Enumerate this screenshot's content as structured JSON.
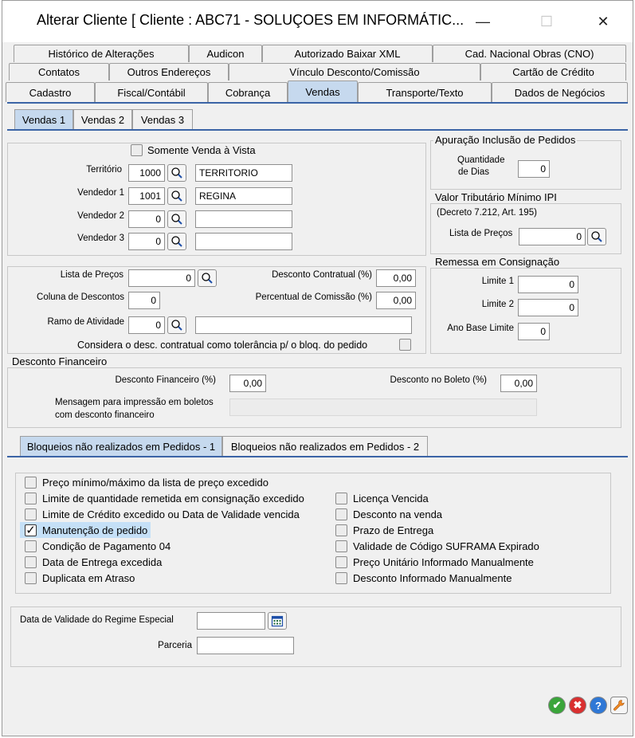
{
  "window": {
    "title": "Alterar Cliente [ Cliente : ABC71 - SOLUÇOES EM INFORMÁTIC...",
    "minimize": "—",
    "maximize": "☐",
    "close": "✕"
  },
  "tabs": {
    "row1": [
      "Histórico de Alterações",
      "Audicon",
      "Autorizado Baixar XML",
      "Cad. Nacional Obras (CNO)"
    ],
    "row2": [
      "Contatos",
      "Outros Endereços",
      "Vínculo Desconto/Comissão",
      "Cartão de Crédito"
    ],
    "row3": [
      "Cadastro",
      "Fiscal/Contábil",
      "Cobrança",
      "Vendas",
      "Transporte/Texto",
      "Dados de Negócios"
    ],
    "active": "Vendas"
  },
  "subtabs": [
    "Vendas 1",
    "Vendas 2",
    "Vendas 3"
  ],
  "vendas_group": {
    "somente_vista_label": "Somente Venda à Vista",
    "territorio_label": "Território",
    "territorio_code": "1000",
    "territorio_name": "TERRITORIO",
    "vendedor1_label": "Vendedor 1",
    "vendedor1_code": "1001",
    "vendedor1_name": "REGINA",
    "vendedor2_label": "Vendedor 2",
    "vendedor2_code": "0",
    "vendedor2_name": "",
    "vendedor3_label": "Vendedor 3",
    "vendedor3_code": "0",
    "vendedor3_name": ""
  },
  "apuracao": {
    "title": "Apuração Inclusão de Pedidos",
    "qtd_label_1": "Quantidade",
    "qtd_label_2": "de Dias",
    "qtd_value": "0"
  },
  "ipi": {
    "title": "Valor Tributário Mínimo IPI",
    "decreto": "(Decreto 7.212, Art. 195)",
    "lista_label": "Lista de Preços",
    "lista_value": "0"
  },
  "lista_group": {
    "lista_label": "Lista de Preços",
    "lista_value": "0",
    "coluna_label": "Coluna de Descontos",
    "coluna_value": "0",
    "ramo_label": "Ramo de Atividade",
    "ramo_value": "0",
    "ramo_name": "",
    "desc_contratual_label": "Desconto Contratual (%)",
    "desc_contratual_value": "0,00",
    "perc_comissao_label": "Percentual de Comissão (%)",
    "perc_comissao_value": "0,00",
    "considera_label": "Considera o desc. contratual como tolerância p/ o bloq. do pedido"
  },
  "remessa": {
    "title": "Remessa em Consignação",
    "limite1_label": "Limite 1",
    "limite1_value": "0",
    "limite2_label": "Limite 2",
    "limite2_value": "0",
    "ano_label": "Ano Base Limite",
    "ano_value": "0"
  },
  "desconto_fin": {
    "title": "Desconto Financeiro",
    "df_label": "Desconto Financeiro (%)",
    "df_value": "0,00",
    "boleto_label": "Desconto no Boleto  (%)",
    "boleto_value": "0,00",
    "msg_label_1": "Mensagem para impressão em boletos",
    "msg_label_2": "com desconto financeiro",
    "msg_value": ""
  },
  "bloq_tabs": [
    "Bloqueios não realizados em Pedidos - 1",
    "Bloqueios não realizados em Pedidos - 2"
  ],
  "bloqueios_left": [
    {
      "label": "Preço mínimo/máximo da lista de preço excedido",
      "checked": false
    },
    {
      "label": "Limite de quantidade remetida em consignação excedido",
      "checked": false
    },
    {
      "label": "Limite de Crédito excedido ou Data de Validade vencida",
      "checked": false
    },
    {
      "label": "Manutenção de pedido",
      "checked": true
    },
    {
      "label": "Condição de Pagamento 04",
      "checked": false
    },
    {
      "label": "Data de Entrega excedida",
      "checked": false
    },
    {
      "label": "Duplicata em Atraso",
      "checked": false
    }
  ],
  "bloqueios_right": [
    {
      "label": "Licença Vencida",
      "checked": false
    },
    {
      "label": "Desconto na venda",
      "checked": false
    },
    {
      "label": "Prazo de Entrega",
      "checked": false
    },
    {
      "label": "Validade de Código SUFRAMA Expirado",
      "checked": false
    },
    {
      "label": "Preço Unitário Informado Manualmente",
      "checked": false
    },
    {
      "label": "Desconto Informado Manualmente",
      "checked": false
    }
  ],
  "regime": {
    "validade_label": "Data de Validade do Regime Especial",
    "validade_value": "",
    "parceria_label": "Parceria",
    "parceria_value": ""
  },
  "buttons": {
    "ok": "✔",
    "cancel": "✖",
    "help": "?",
    "tools": "🔧"
  },
  "colors": {
    "active_tab": "#c6d9ee",
    "tab_line": "#3b64a6",
    "ok": "#3aa53a",
    "cancel": "#d93030",
    "help": "#2f78d6",
    "tools": "#f08a24"
  }
}
